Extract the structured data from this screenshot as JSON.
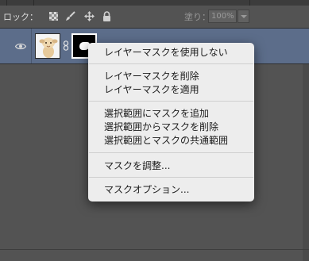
{
  "lock_bar": {
    "lock_label": "ロック：",
    "fill_label": "塗り：",
    "fill_value": "100%"
  },
  "layer": {
    "selected": true,
    "visible": true,
    "linked": true
  },
  "context_menu": {
    "groups": [
      [
        "レイヤーマスクを使用しない"
      ],
      [
        "レイヤーマスクを削除",
        "レイヤーマスクを適用"
      ],
      [
        "選択範囲にマスクを追加",
        "選択範囲からマスクを削除",
        "選択範囲とマスクの共通範囲"
      ],
      [
        "マスクを調整..."
      ],
      [
        "マスクオプション..."
      ]
    ]
  },
  "colors": {
    "panel_bg": "#535353",
    "selected_row": "#5c6d8a",
    "menu_bg": "#ededed"
  },
  "icons": {
    "visibility": "eye-icon",
    "lock_transparent": "checkerboard-icon",
    "lock_image": "brush-icon",
    "lock_position": "move-icon",
    "lock_all": "lock-icon",
    "link": "chain-link-icon"
  }
}
